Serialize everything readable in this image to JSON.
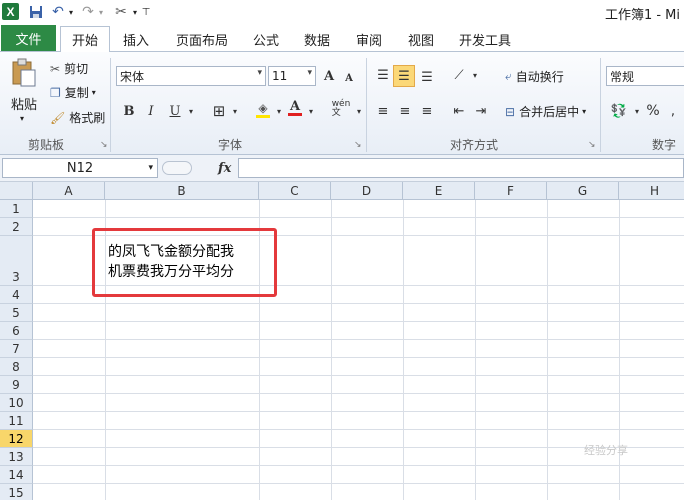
{
  "window": {
    "title": "工作簿1 - Mi"
  },
  "tabs": [
    {
      "label": "文件"
    },
    {
      "label": "开始"
    },
    {
      "label": "插入"
    },
    {
      "label": "页面布局"
    },
    {
      "label": "公式"
    },
    {
      "label": "数据"
    },
    {
      "label": "审阅"
    },
    {
      "label": "视图"
    },
    {
      "label": "开发工具"
    }
  ],
  "ribbon": {
    "clipboard": {
      "paste": "粘贴",
      "cut": "剪切",
      "copy": "复制",
      "format_painter": "格式刷",
      "group": "剪贴板"
    },
    "font": {
      "name": "宋体",
      "size": "11",
      "group": "字体"
    },
    "alignment": {
      "wrap": "自动换行",
      "merge": "合并后居中",
      "group": "对齐方式"
    },
    "number": {
      "format": "常规",
      "percent": "%",
      "group": "数字"
    }
  },
  "formula_bar": {
    "name_box": "N12",
    "fx": "fx",
    "value": ""
  },
  "sheet": {
    "columns": [
      "A",
      "B",
      "C",
      "D",
      "E",
      "F",
      "G",
      "H"
    ],
    "rows": [
      "1",
      "2",
      "3",
      "4",
      "5",
      "6",
      "7",
      "8",
      "9",
      "10",
      "11",
      "12",
      "13",
      "14",
      "15"
    ],
    "selected_row": "12",
    "cell_b3_line1": "的凤飞飞金额分配我",
    "cell_b3_line2": "机票费我万分平均分"
  },
  "watermark": "经验分享",
  "colors": {
    "file_tab": "#2d8a45",
    "highlight": "#e4393c",
    "selected_row": "#f8d66a"
  }
}
